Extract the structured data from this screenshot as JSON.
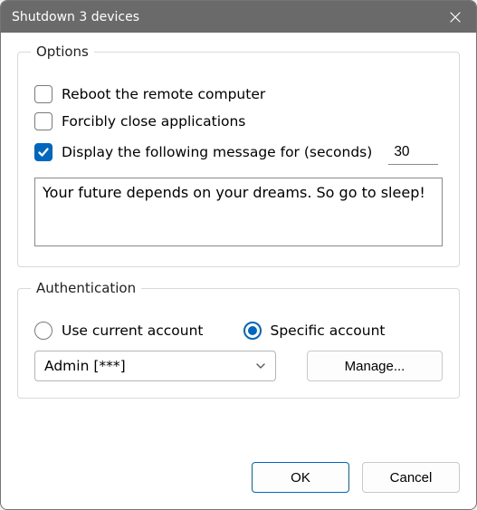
{
  "window": {
    "title": "Shutdown 3 devices"
  },
  "options": {
    "legend": "Options",
    "reboot_label": "Reboot the remote computer",
    "reboot_checked": false,
    "force_label": "Forcibly close applications",
    "force_checked": false,
    "display_msg_label": "Display the following message for (seconds)",
    "display_msg_checked": true,
    "seconds_value": "30",
    "message_value": "Your future depends on your dreams. So go to sleep!"
  },
  "auth": {
    "legend": "Authentication",
    "use_current_label": "Use current account",
    "use_current_selected": false,
    "specific_label": "Specific account",
    "specific_selected": true,
    "account_selected": "Admin [***]",
    "manage_label": "Manage..."
  },
  "footer": {
    "ok_label": "OK",
    "cancel_label": "Cancel"
  }
}
